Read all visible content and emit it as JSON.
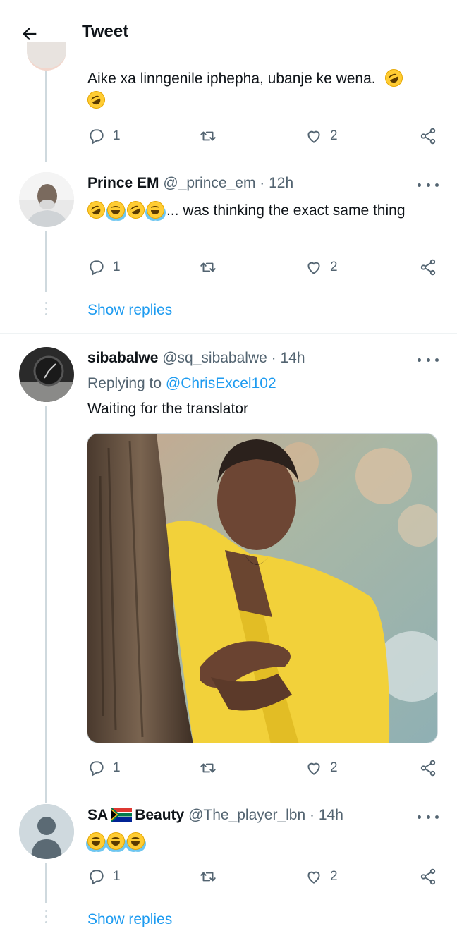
{
  "header": {
    "title": "Tweet",
    "back_icon": "back-arrow-icon"
  },
  "colors": {
    "accent": "#1d9bf0",
    "text": "#0f1419",
    "secondary": "#536471",
    "line": "#cfd9de"
  },
  "tweets": [
    {
      "text": "Aike xa linngenile iphepha, ubanje ke wena.",
      "stats": {
        "replies": "1",
        "likes": "2"
      }
    },
    {
      "name": "Prince EM",
      "handle": "@_prince_em",
      "dot": "·",
      "time": "12h",
      "text": "... was thinking the exact same thing",
      "stats": {
        "replies": "1",
        "likes": "2"
      },
      "show_replies": "Show replies"
    },
    {
      "name": "sibabalwe",
      "handle": "@sq_sibabalwe",
      "dot": "·",
      "time": "14h",
      "replying_label": "Replying to",
      "replying_handle": "@ChrisExcel102",
      "text": "Waiting for the translator",
      "stats": {
        "replies": "1",
        "likes": "2"
      }
    },
    {
      "name_part1": "SA",
      "name_part2": "Beauty",
      "handle": "@The_player_lbn",
      "dot": "·",
      "time": "14h",
      "stats": {
        "replies": "1",
        "likes": "2"
      },
      "show_replies": "Show replies"
    }
  ]
}
